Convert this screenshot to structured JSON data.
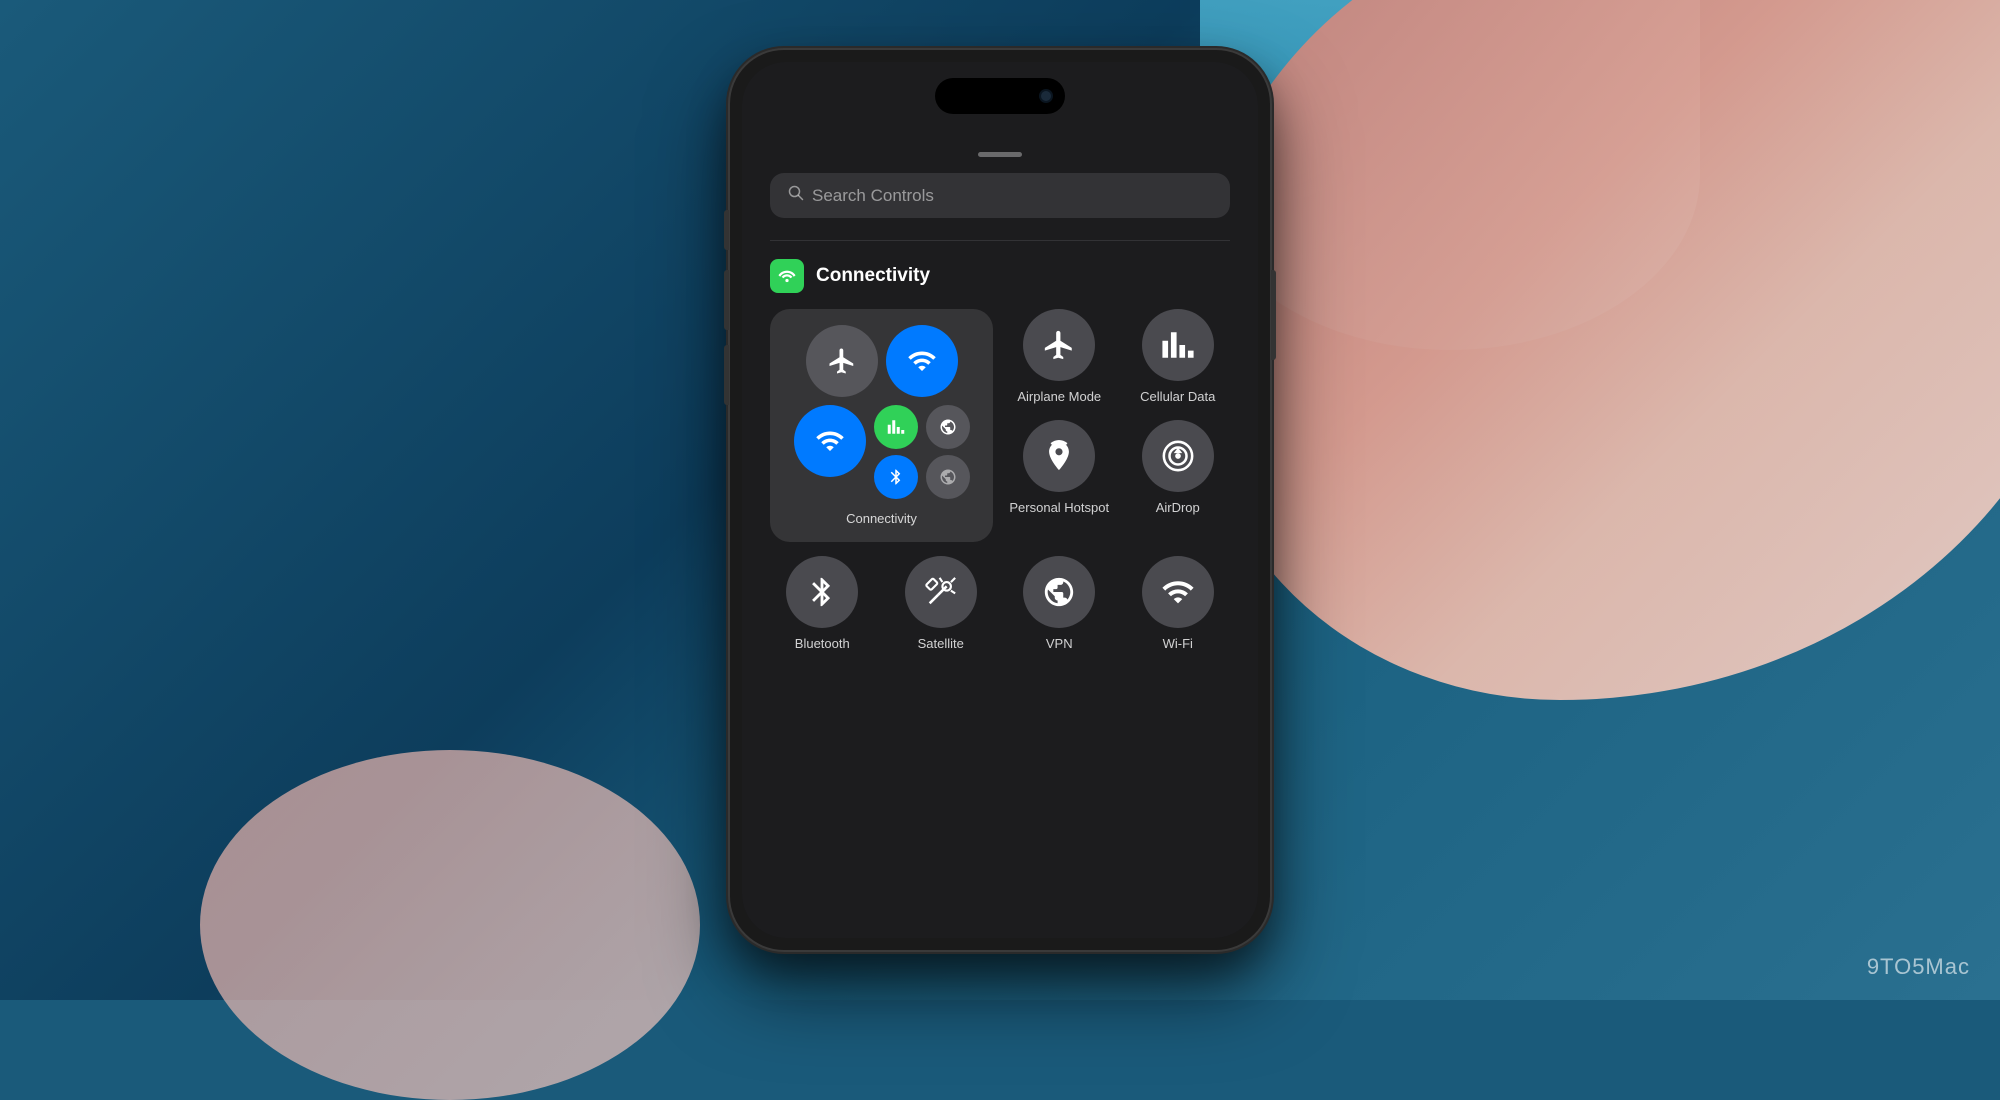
{
  "background": {
    "primary_color": "#1a5a7a",
    "pink_accent": "#e8a090",
    "blue_accent": "#4ab0d0"
  },
  "watermark": {
    "text": "9TO5Mac"
  },
  "phone": {
    "dynamic_island": true
  },
  "control_center": {
    "drag_handle": true,
    "search": {
      "placeholder": "Search Controls"
    },
    "connectivity_section": {
      "icon_label": "📶",
      "title": "Connectivity",
      "widget_label": "Connectivity",
      "buttons": {
        "airplane": {
          "icon": "✈",
          "active": false
        },
        "wifi_calling": {
          "icon": "📶",
          "active": true
        },
        "wifi": {
          "icon": "📶",
          "active": true
        },
        "cellular": {
          "icon": "📊",
          "active": true
        },
        "bluetooth": {
          "icon": "✱",
          "active": true
        },
        "vpn2": {
          "icon": "🔗",
          "active": false
        },
        "globe": {
          "icon": "🌐",
          "active": false
        }
      }
    },
    "standalone_controls": [
      {
        "id": "airplane-mode",
        "icon": "✈",
        "label": "Airplane Mode",
        "active": false
      },
      {
        "id": "cellular-data",
        "icon": "📊",
        "label": "Cellular Data",
        "active": false
      },
      {
        "id": "personal-hotspot",
        "icon": "📡",
        "label": "Personal Hotspot",
        "active": false
      },
      {
        "id": "airdrop",
        "icon": "🎯",
        "label": "AirDrop",
        "active": false
      },
      {
        "id": "bluetooth",
        "icon": "✱",
        "label": "Bluetooth",
        "active": false
      },
      {
        "id": "satellite",
        "icon": "🛰",
        "label": "Satellite",
        "active": false
      },
      {
        "id": "vpn",
        "icon": "🌐",
        "label": "VPN",
        "active": false
      },
      {
        "id": "wifi",
        "icon": "📶",
        "label": "Wi-Fi",
        "active": false
      }
    ]
  }
}
